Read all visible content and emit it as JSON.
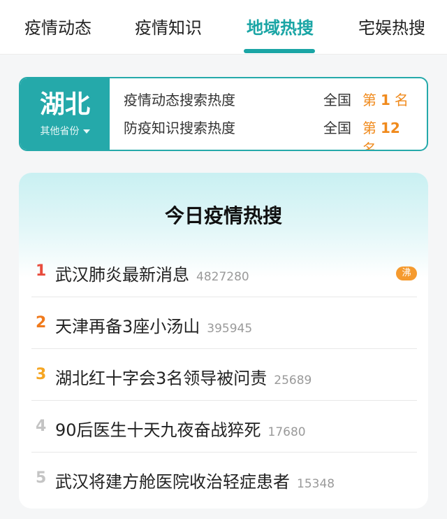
{
  "tabs": [
    {
      "label": "疫情动态"
    },
    {
      "label": "疫情知识"
    },
    {
      "label": "地域热搜"
    },
    {
      "label": "宅娱热搜"
    }
  ],
  "province": {
    "name": "湖北",
    "switch_label": "其他省份",
    "rankings": [
      {
        "label": "疫情动态搜索热度",
        "scope": "全国",
        "prefix": "第",
        "rank": "1",
        "suffix": "名"
      },
      {
        "label": "防疫知识搜索热度",
        "scope": "全国",
        "prefix": "第",
        "rank": "12",
        "suffix": "名"
      }
    ]
  },
  "hot": {
    "title": "今日疫情热搜",
    "items": [
      {
        "rank": "1",
        "title": "武汉肺炎最新消息",
        "count": "4827280",
        "badge": "沸"
      },
      {
        "rank": "2",
        "title": "天津再备3座小汤山",
        "count": "395945"
      },
      {
        "rank": "3",
        "title": "湖北红十字会3名领导被问责",
        "count": "25689"
      },
      {
        "rank": "4",
        "title": "90后医生十天九夜奋战猝死",
        "count": "17680"
      },
      {
        "rank": "5",
        "title": "武汉将建方舱医院收治轻症患者",
        "count": "15348"
      }
    ]
  },
  "colors": {
    "accent": "#25a9aa",
    "rank_1": "#e84c3d",
    "rank_2": "#f07a1c",
    "rank_3": "#f5a623",
    "rank_other": "#c4c4c4",
    "highlight": "#f08a1c"
  }
}
